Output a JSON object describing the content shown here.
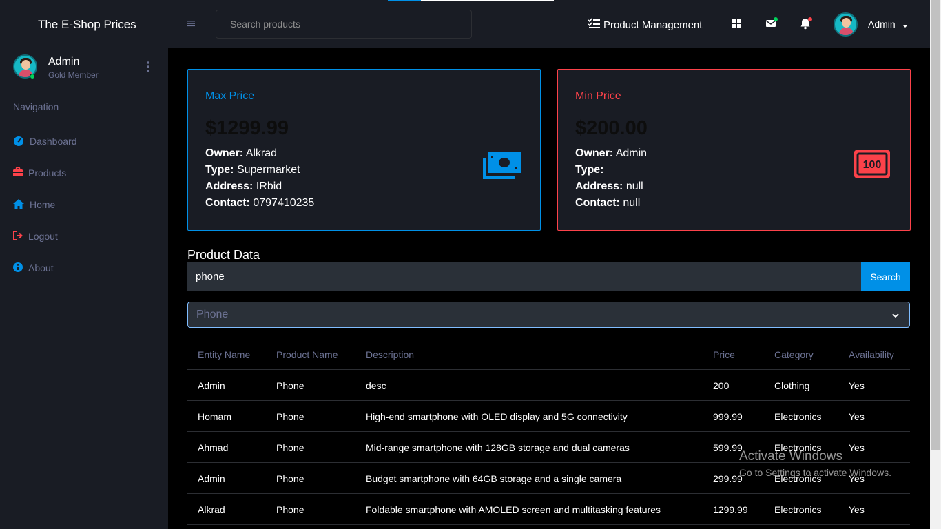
{
  "header": {
    "brand": "The E-Shop Prices",
    "search_placeholder": "Search products",
    "product_management": "Product Management",
    "user_label": "Admin",
    "page_load_progress": 0.2
  },
  "sidebar": {
    "profile_name": "Admin",
    "profile_role": "Gold Member",
    "nav_heading": "Navigation",
    "items": [
      {
        "label": "Dashboard",
        "icon": "speedometer-icon"
      },
      {
        "label": "Products",
        "icon": "briefcase-icon"
      },
      {
        "label": "Home",
        "icon": "home-icon"
      },
      {
        "label": "Logout",
        "icon": "logout-icon"
      },
      {
        "label": "About",
        "icon": "info-icon"
      }
    ]
  },
  "cards": {
    "max": {
      "title": "Max Price",
      "price": "$1299.99",
      "owner_label": "Owner:",
      "owner": "Alkrad",
      "type_label": "Type:",
      "type": "Supermarket",
      "address_label": "Address:",
      "address": "IRbid",
      "contact_label": "Contact:",
      "contact": "0797410235",
      "icon": "cash-icon",
      "color": "#0090e7"
    },
    "min": {
      "title": "Min Price",
      "price": "$200.00",
      "owner_label": "Owner:",
      "owner": "Admin",
      "type_label": "Type:",
      "type": "",
      "address_label": "Address:",
      "address": "null",
      "contact_label": "Contact:",
      "contact": "null",
      "icon": "banknote-100-icon",
      "color": "#fc424a"
    }
  },
  "product_data": {
    "title": "Product Data",
    "filter_value": "phone",
    "search_button": "Search",
    "select_value": "Phone"
  },
  "table": {
    "headers": [
      "Entity Name",
      "Product Name",
      "Description",
      "Price",
      "Category",
      "Availability"
    ],
    "rows": [
      [
        "Admin",
        "Phone",
        "desc",
        "200",
        "Clothing",
        "Yes"
      ],
      [
        "Homam",
        "Phone",
        "High-end smartphone with OLED display and 5G connectivity",
        "999.99",
        "Electronics",
        "Yes"
      ],
      [
        "Ahmad",
        "Phone",
        "Mid-range smartphone with 128GB storage and dual cameras",
        "599.99",
        "Electronics",
        "Yes"
      ],
      [
        "Admin",
        "Phone",
        "Budget smartphone with 64GB storage and a single camera",
        "299.99",
        "Electronics",
        "Yes"
      ],
      [
        "Alkrad",
        "Phone",
        "Foldable smartphone with AMOLED screen and multitasking features",
        "1299.99",
        "Electronics",
        "Yes"
      ]
    ]
  },
  "watermark": {
    "title": "Activate Windows",
    "subtitle": "Go to Settings to activate Windows."
  }
}
